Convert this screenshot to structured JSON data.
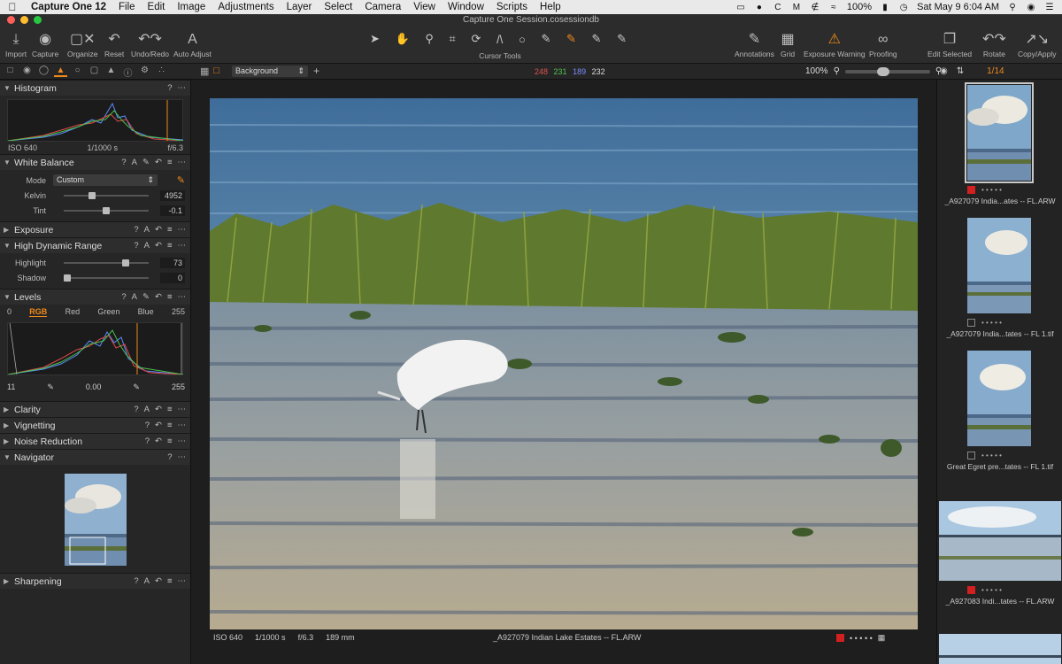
{
  "menubar": {
    "app_name": "Capture One 12",
    "items": [
      "File",
      "Edit",
      "Image",
      "Adjustments",
      "Layer",
      "Select",
      "Camera",
      "View",
      "Window",
      "Scripts",
      "Help"
    ],
    "battery": "100%",
    "clock": "Sat May 9  6:04 AM"
  },
  "window": {
    "title": "Capture One Session.cosessiondb"
  },
  "toolbar": {
    "left": [
      {
        "label": "Import",
        "icon": "import-icon"
      },
      {
        "label": "Capture",
        "icon": "camera-icon"
      },
      {
        "label": "Organize",
        "icon": "organize-icon"
      },
      {
        "label": "Reset",
        "icon": "reset-icon"
      },
      {
        "label": "Undo/Redo",
        "icon": "undo-icon"
      },
      {
        "label": "Auto Adjust",
        "icon": "auto-adjust-icon"
      }
    ],
    "cursor_tools_label": "Cursor Tools",
    "right": [
      {
        "label": "Annotations",
        "icon": "annotations-icon"
      },
      {
        "label": "Grid",
        "icon": "grid-icon"
      },
      {
        "label": "Exposure Warning",
        "icon": "warning-icon"
      },
      {
        "label": "Proofing",
        "icon": "glasses-icon"
      },
      {
        "label": "Edit Selected",
        "icon": "edit-selected-icon"
      },
      {
        "label": "Rotate",
        "icon": "rotate-icon"
      },
      {
        "label": "Copy/Apply",
        "icon": "copy-apply-icon"
      }
    ]
  },
  "viewer_bar": {
    "background_select": "Background",
    "rgb": {
      "r": "248",
      "g": "231",
      "b": "189",
      "l": "232"
    },
    "zoom": "100%",
    "browser_count": "1/14"
  },
  "tools": {
    "histogram": {
      "title": "Histogram",
      "iso": "ISO 640",
      "shutter": "1/1000 s",
      "aperture": "f/6.3"
    },
    "white_balance": {
      "title": "White Balance",
      "mode_label": "Mode",
      "mode_value": "Custom",
      "kelvin_label": "Kelvin",
      "kelvin_value": "4952",
      "tint_label": "Tint",
      "tint_value": "-0.1"
    },
    "exposure": {
      "title": "Exposure"
    },
    "hdr": {
      "title": "High Dynamic Range",
      "highlight_label": "Highlight",
      "highlight_value": "73",
      "shadow_label": "Shadow",
      "shadow_value": "0"
    },
    "levels": {
      "title": "Levels",
      "in_low": "0",
      "in_high": "255",
      "tabs": [
        "RGB",
        "Red",
        "Green",
        "Blue"
      ],
      "out_low": "11",
      "mid": "0.00",
      "out_high": "255"
    },
    "clarity": {
      "title": "Clarity"
    },
    "vignetting": {
      "title": "Vignetting"
    },
    "noise": {
      "title": "Noise Reduction"
    },
    "navigator": {
      "title": "Navigator"
    },
    "sharpening": {
      "title": "Sharpening"
    }
  },
  "infobar": {
    "iso": "ISO 640",
    "shutter": "1/1000 s",
    "aperture": "f/6.3",
    "focal": "189 mm",
    "filename": "_A927079 Indian Lake Estates -- FL.ARW"
  },
  "browser": {
    "items": [
      {
        "label": "_A927079 India...ates -- FL.ARW",
        "tag": "red",
        "selected": true
      },
      {
        "label": "_A927079 India...tates -- FL 1.tif",
        "tag": "none",
        "selected": false
      },
      {
        "label": "Great Egret pre...tates -- FL 1.tif",
        "tag": "none",
        "selected": false
      },
      {
        "label": "_A927083 Indi...tates -- FL.ARW",
        "tag": "red",
        "selected": false
      }
    ]
  },
  "colors": {
    "accent": "#f08a1a",
    "tag_red": "#d21f1f",
    "panel": "#262626"
  }
}
